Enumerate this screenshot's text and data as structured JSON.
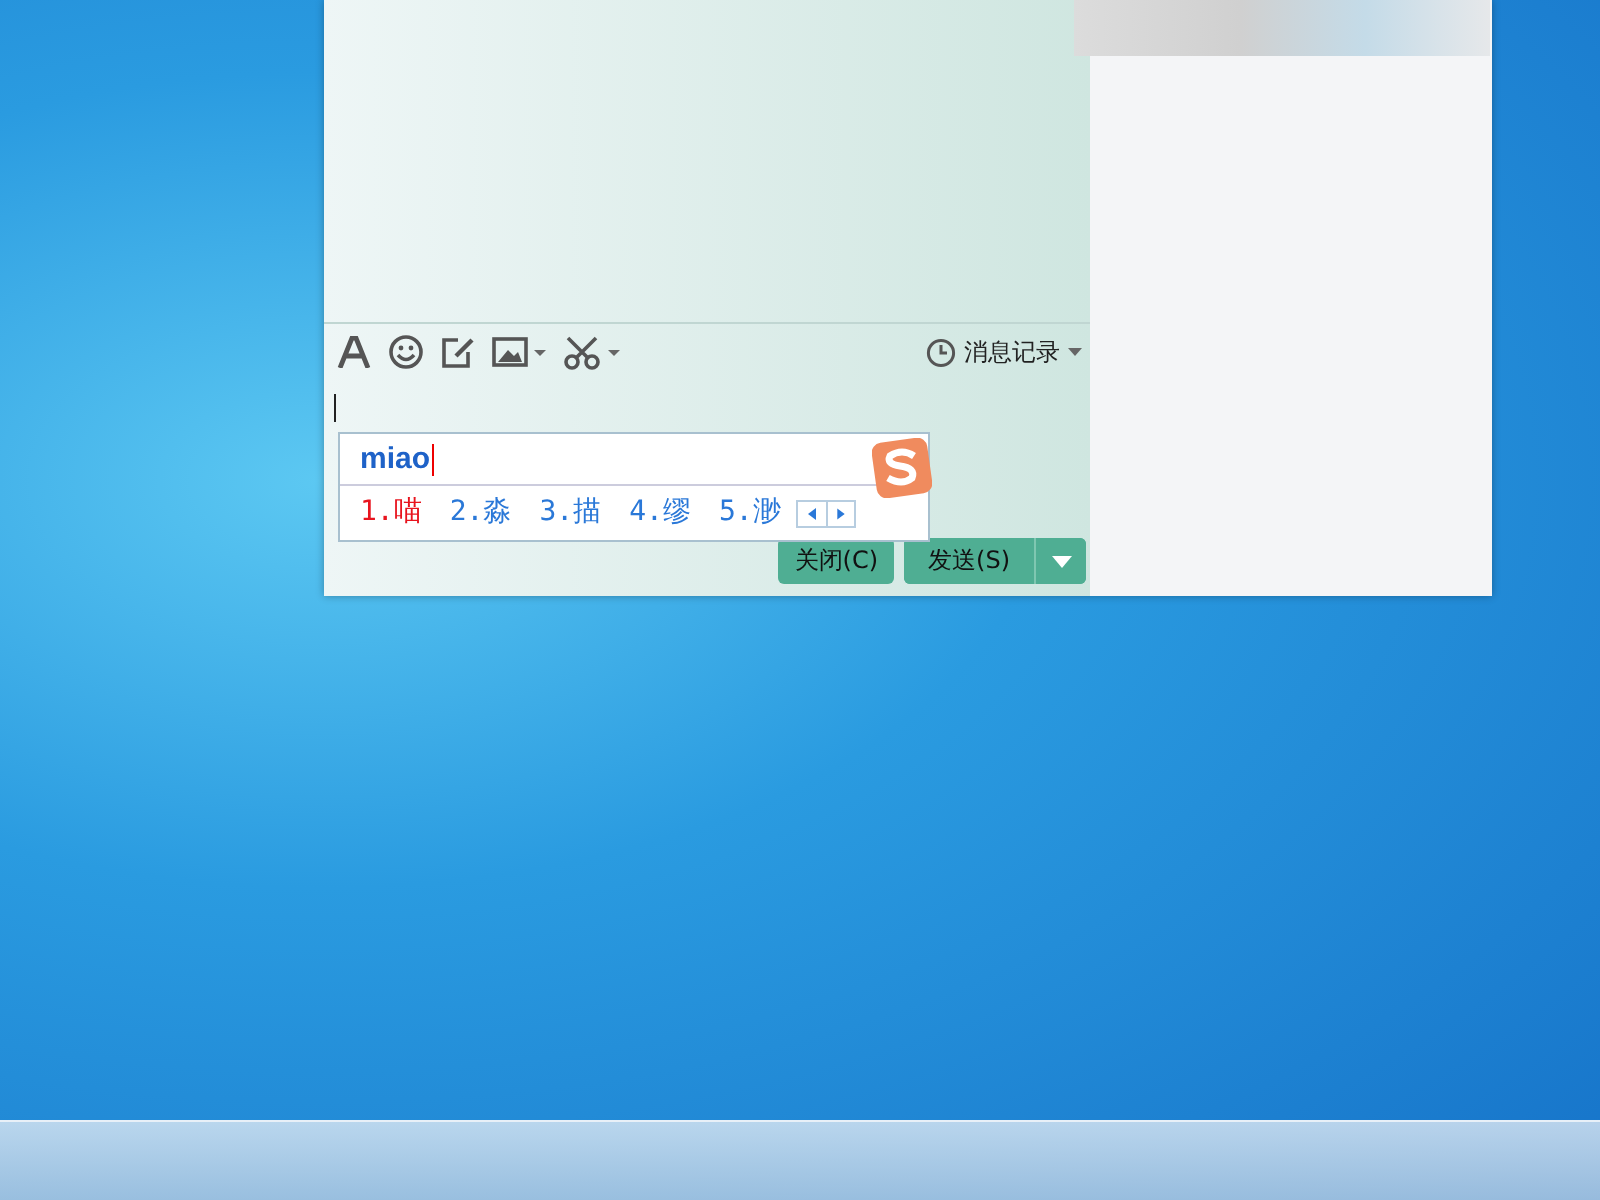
{
  "chat_window": {
    "toolbar": {
      "history_label": "消息记录"
    },
    "ime": {
      "composition": "miao",
      "candidates": [
        {
          "label": "1.喵",
          "selected": true
        },
        {
          "label": "2.淼",
          "selected": false
        },
        {
          "label": "3.描",
          "selected": false
        },
        {
          "label": "4.缪",
          "selected": false
        },
        {
          "label": "5.渺",
          "selected": false
        }
      ]
    },
    "buttons": [
      {
        "label": "关闭(C)",
        "kind": "close"
      },
      {
        "label": "发送(S)",
        "kind": "send"
      }
    ]
  }
}
